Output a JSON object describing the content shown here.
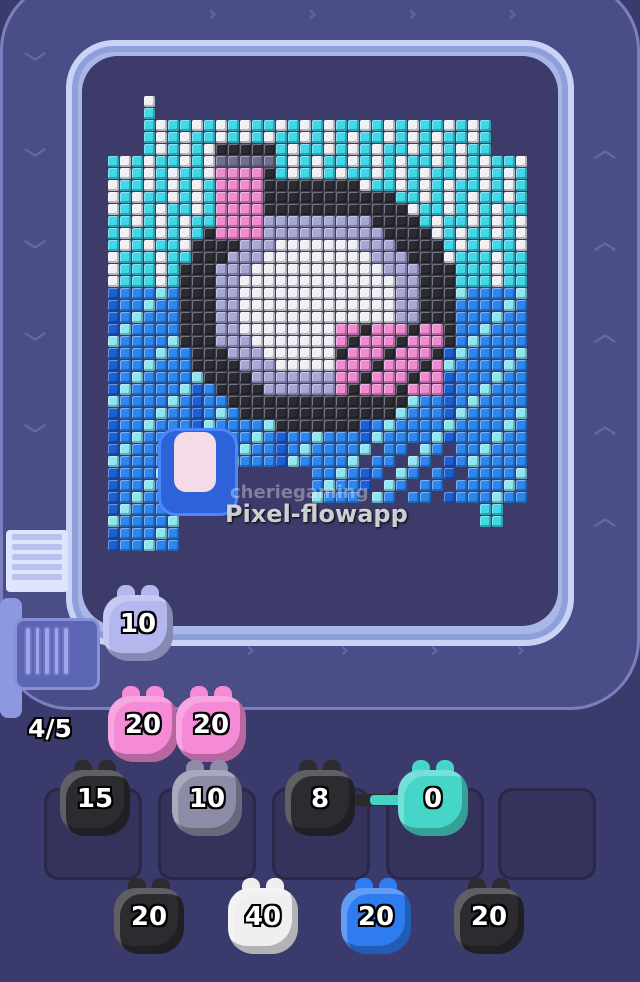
{
  "watermark": {
    "line1": "cheriegaming",
    "line2": "Pixel-flowapp"
  },
  "launcher": {
    "capacity": "4/5"
  },
  "colors": {
    "cyan": "#3fd8e8",
    "white": "#f0f0f6",
    "black": "#2b2b33",
    "gray": "#6f6e8c",
    "lavender": "#a7a8d6",
    "pink": "#f08bd0",
    "blue": "#2f86ef",
    "dark_blue": "#1b5fd2",
    "light_blue": "#8fe6f3"
  },
  "queue_front": {
    "value": "10",
    "color": "#b3b7ee"
  },
  "queue_waiting": [
    {
      "value": "20",
      "color": "#f58ad6"
    },
    {
      "value": "20",
      "color": "#f58ad6"
    }
  ],
  "slots": [
    {
      "value": "15",
      "color": "#2b2b30"
    },
    {
      "value": "10",
      "color": "#8d8ca6"
    },
    {
      "value": "8",
      "color": "#2b2b30"
    },
    {
      "value": "0",
      "color": "#46d6c8"
    },
    {
      "value": "",
      "color": ""
    }
  ],
  "reserve": [
    {
      "value": "20",
      "color": "#2b2b30"
    },
    {
      "value": "40",
      "color": "#efefef"
    },
    {
      "value": "20",
      "color": "#2f7bf0"
    },
    {
      "value": "20",
      "color": "#2b2b30"
    }
  ],
  "icons": [
    "chevron-up-icon",
    "chevron-down-icon",
    "chevron-right-icon",
    "pig-icon"
  ]
}
